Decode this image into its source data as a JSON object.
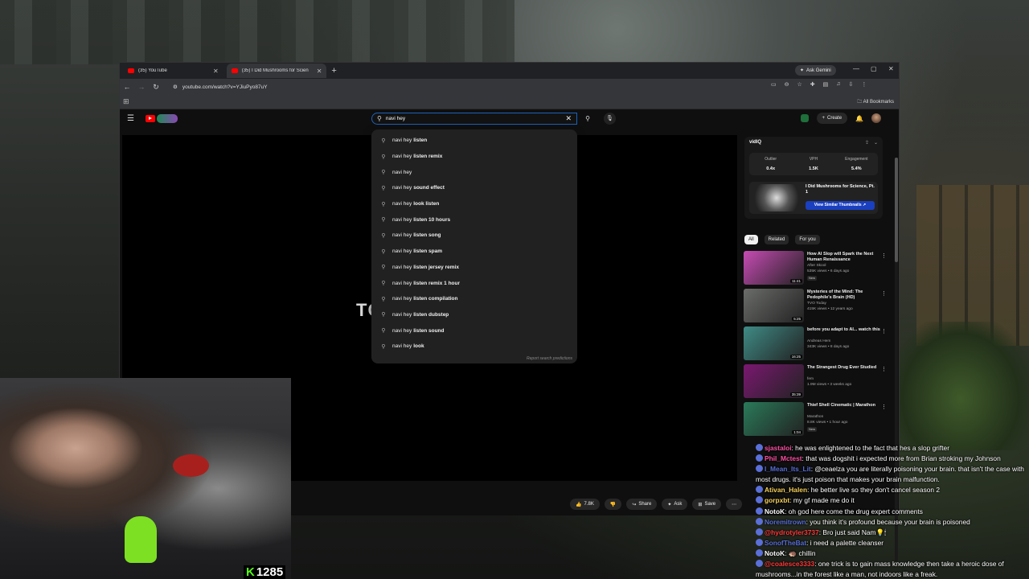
{
  "browser": {
    "tabs": [
      {
        "title": "(35) YouTube",
        "active": false
      },
      {
        "title": "(35) I Did Mushrooms for Scien",
        "active": true
      }
    ],
    "gemini_label": "Ask Gemini",
    "url": "youtube.com/watch?v=YJiuPyo87uY",
    "all_bookmarks": "All Bookmarks"
  },
  "youtube": {
    "search": {
      "query": "navi hey",
      "suggestions": [
        {
          "prefix": "navi hey",
          "rest": "listen"
        },
        {
          "prefix": "navi hey",
          "rest": "listen remix"
        },
        {
          "prefix": "navi hey",
          "rest": ""
        },
        {
          "prefix": "navi hey",
          "rest": "sound effect"
        },
        {
          "prefix": "navi hey",
          "rest": "look listen"
        },
        {
          "prefix": "navi hey",
          "rest": "listen 10 hours"
        },
        {
          "prefix": "navi hey",
          "rest": "listen song"
        },
        {
          "prefix": "navi hey",
          "rest": "listen spam"
        },
        {
          "prefix": "navi hey",
          "rest": "listen jersey remix"
        },
        {
          "prefix": "navi hey",
          "rest": "listen remix 1 hour"
        },
        {
          "prefix": "navi hey",
          "rest": "listen compilation"
        },
        {
          "prefix": "navi hey",
          "rest": "listen dubstep"
        },
        {
          "prefix": "navi hey",
          "rest": "listen sound"
        },
        {
          "prefix": "navi hey",
          "rest": "look"
        }
      ],
      "report_label": "Report search predictions"
    },
    "create_label": "Create",
    "video_overlay_text": "TC",
    "actions": {
      "likes": "7.8K",
      "share": "Share",
      "ask": "Ask",
      "save": "Save"
    },
    "extension": {
      "logo": "vidIQ",
      "stats": [
        {
          "label": "Outlier",
          "value": "0.4x"
        },
        {
          "label": "VPH",
          "value": "1.5K"
        },
        {
          "label": "Engagement",
          "value": "5.4%"
        }
      ],
      "similar_title": "I Did Mushrooms for Science, Pt. 1",
      "similar_button": "View Similar Thumbnails ↗"
    },
    "chips": [
      "All",
      "Related",
      "For you"
    ],
    "related": [
      {
        "title": "How AI Slop will Spark the Next Human Renaissance",
        "channel": "After Skool",
        "stats": "535K views • 6 days ago",
        "badge": "New",
        "duration": "11:41",
        "thumb_color": "#c74bb4"
      },
      {
        "title": "Mysteries of the Mind: The Pedophile's Brain (HD)",
        "channel": "TVO Today",
        "stats": "415K views • 12 years ago",
        "badge": "",
        "duration": "5:25",
        "thumb_color": "#6b6d6a"
      },
      {
        "title": "before you adapt to AI... watch this",
        "channel": "Andreas Hem",
        "stats": "343K views • 8 days ago",
        "badge": "",
        "duration": "16:25",
        "thumb_color": "#3f8b86"
      },
      {
        "title": "The Strangest Drug Ever Studied",
        "channel": "fem",
        "stats": "1.9M views • 3 weeks ago",
        "badge": "",
        "duration": "35:39",
        "thumb_color": "#7a1870"
      },
      {
        "title": "Thief Shell Cinematic | Marathon",
        "channel": "Marathon",
        "stats": "8.8K views • 1 hour ago",
        "badge": "New",
        "duration": "1:04",
        "thumb_color": "#2a7a5a"
      }
    ]
  },
  "stream": {
    "kick_count": "1285",
    "accent": "#53fc18"
  },
  "chat": [
    {
      "user": "sjastaloi",
      "color": "#ff4fa3",
      "text": ": he was enlightened to the fact that hes a slop grifter"
    },
    {
      "user": "Phil_Mctest",
      "color": "#ff4fa3",
      "text": ": that was dogshit i expected more from Brian stroking my Johnson"
    },
    {
      "user": "I_Mean_Its_Lit",
      "color": "#5a6fd8",
      "text": ": @ceaelza you are literally poisoning your brain. that isn't the case with most drugs. it's just poison that makes your brain malfunction.",
      "wrap": true
    },
    {
      "user": "Ativan_Halen",
      "color": "#f6d05a",
      "text": ": he better live so they don't cancel season 2"
    },
    {
      "user": "gorpxbt",
      "color": "#f6d05a",
      "text": ": my gf made me do it"
    },
    {
      "user": "NotoK",
      "color": "#ffffff",
      "text": ": oh god here come the drug expert comments"
    },
    {
      "user": "Noremitrown",
      "color": "#5a6fd8",
      "text": ": you think it's profound because your brain is poisoned"
    },
    {
      "user": "@hydrotyler3737",
      "color": "#ff3b3b",
      "text": ": Bro just said Nam💡🕯"
    },
    {
      "user": "SonofTheBat",
      "color": "#5a6fd8",
      "text": ": i need a palette cleanser"
    },
    {
      "user": "NotoK",
      "color": "#ffffff",
      "text": ": 🦔 chillin"
    },
    {
      "user": "@coalesce3333",
      "color": "#ff3b3b",
      "text": ": one trick is to gain mass knowledge then take a heroic dose of mushrooms...in the forest like a man, not indoors like a freak.",
      "wrap": true
    }
  ]
}
